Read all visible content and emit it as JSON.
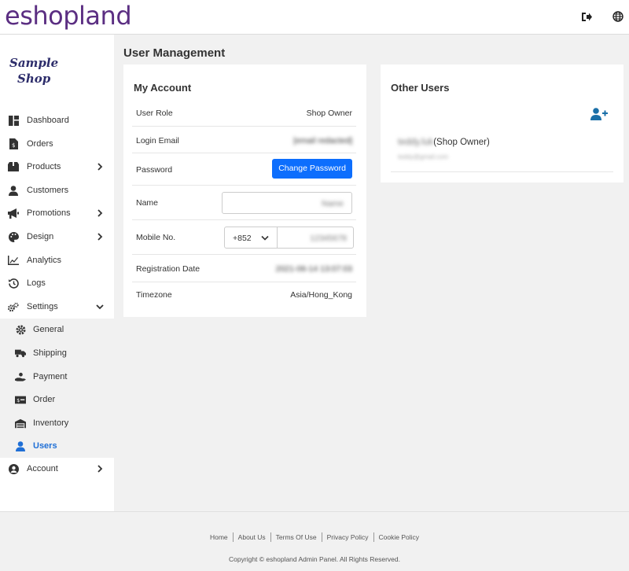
{
  "header": {
    "brand": "eshopland",
    "icons": [
      "logout-icon",
      "globe-icon"
    ]
  },
  "sidebar": {
    "shop_logo_line1": "Sample",
    "shop_logo_line2": "Shop",
    "items": [
      {
        "label": "Dashboard",
        "icon": "dashboard-icon"
      },
      {
        "label": "Orders",
        "icon": "orders-icon"
      },
      {
        "label": "Products",
        "icon": "products-icon",
        "has_children": true
      },
      {
        "label": "Customers",
        "icon": "customers-icon"
      },
      {
        "label": "Promotions",
        "icon": "megaphone-icon",
        "has_children": true
      },
      {
        "label": "Design",
        "icon": "palette-icon",
        "has_children": true
      },
      {
        "label": "Analytics",
        "icon": "chart-icon"
      },
      {
        "label": "Logs",
        "icon": "history-icon"
      },
      {
        "label": "Settings",
        "icon": "cogs-icon",
        "expanded": true
      }
    ],
    "settings_sub": [
      {
        "label": "General",
        "icon": "gear-icon"
      },
      {
        "label": "Shipping",
        "icon": "truck-icon"
      },
      {
        "label": "Payment",
        "icon": "hand-coin-icon"
      },
      {
        "label": "Order",
        "icon": "money-icon"
      },
      {
        "label": "Inventory",
        "icon": "warehouse-icon"
      },
      {
        "label": "Users",
        "icon": "user-icon",
        "active": true
      }
    ],
    "account": {
      "label": "Account",
      "icon": "user-circle-icon",
      "has_children": true
    }
  },
  "main": {
    "title": "User Management",
    "my_account": {
      "title": "My Account",
      "user_role_label": "User Role",
      "user_role_value": "Shop Owner",
      "login_email_label": "Login Email",
      "login_email_value": "[email redacted]",
      "password_label": "Password",
      "change_password_button": "Change Password",
      "name_label": "Name",
      "name_value": "Name",
      "mobile_label": "Mobile No.",
      "country_code": "+852",
      "mobile_value": "12345678",
      "registration_label": "Registration Date",
      "registration_value": "2021-06-14 13:07:03",
      "timezone_label": "Timezone",
      "timezone_value": "Asia/Hong_Kong"
    },
    "other_users": {
      "title": "Other Users",
      "users": [
        {
          "name_blurred": "teddy.luk",
          "role": "(Shop Owner)",
          "email_blurred": "teddy@gmail.com"
        }
      ]
    }
  },
  "footer": {
    "links": [
      "Home",
      "About Us",
      "Terms Of Use",
      "Privacy Policy",
      "Cookie Policy"
    ],
    "copyright": "Copyright © eshopland Admin Panel. All Rights Reserved."
  },
  "colors": {
    "brand": "#5b2e82",
    "primary": "#0d6efd",
    "active": "#1f6fd6",
    "icon_blue": "#1a6fa8"
  }
}
